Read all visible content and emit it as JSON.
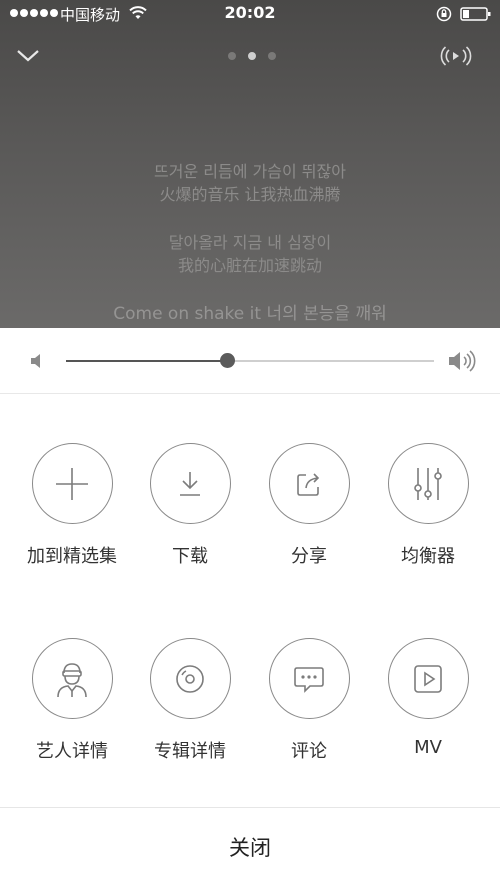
{
  "status_bar": {
    "carrier": "中国移动",
    "time": "20:02"
  },
  "player": {
    "page_indicator": {
      "count": 3,
      "active_index": 1
    },
    "lyrics": [
      {
        "kr": "뜨거운 리듬에 가슴이 뛰잖아",
        "cn": "火爆的音乐 让我热血沸腾"
      },
      {
        "kr": "달아올라 지금 내 심장이",
        "cn": "我的心脏在加速跳动"
      }
    ],
    "lyric_next": "Come on shake it 너의 본능을 깨워"
  },
  "volume": {
    "level": 0.44
  },
  "actions": [
    {
      "label": "加到精选集",
      "icon": "plus-icon"
    },
    {
      "label": "下载",
      "icon": "download-icon"
    },
    {
      "label": "分享",
      "icon": "share-icon"
    },
    {
      "label": "均衡器",
      "icon": "equalizer-icon"
    },
    {
      "label": "艺人详情",
      "icon": "artist-icon"
    },
    {
      "label": "专辑详情",
      "icon": "album-icon"
    },
    {
      "label": "评论",
      "icon": "comment-icon"
    },
    {
      "label": "MV",
      "icon": "mv-icon"
    }
  ],
  "close_label": "关闭",
  "colors": {
    "accent": "#5b5b5b",
    "player_bg": "#555453"
  }
}
